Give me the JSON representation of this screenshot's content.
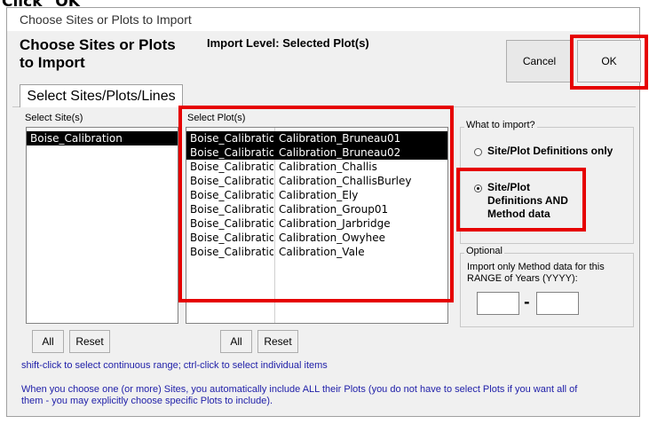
{
  "caption": "Click \"OK\"",
  "window": {
    "title": "Choose Sites or Plots to Import"
  },
  "header": {
    "heading": "Choose Sites or Plots to Import",
    "import_level": "Import Level: Selected Plot(s)"
  },
  "buttons": {
    "cancel": "Cancel",
    "ok": "OK"
  },
  "tab": {
    "label": "Select Sites/Plots/Lines"
  },
  "sites": {
    "label": "Select Site(s)",
    "items": [
      {
        "name": "Boise_Calibration",
        "selected": true
      }
    ],
    "all_label": "All",
    "reset_label": "Reset"
  },
  "plots": {
    "label": "Select Plot(s)",
    "rows": [
      {
        "site": "Boise_Calibratio",
        "plot": "Calibration_Bruneau01",
        "selected": true
      },
      {
        "site": "Boise_Calibratio",
        "plot": "Calibration_Bruneau02",
        "selected": true
      },
      {
        "site": "Boise_Calibratio",
        "plot": "Calibration_Challis",
        "selected": false
      },
      {
        "site": "Boise_Calibratio",
        "plot": "Calibration_ChallisBurley",
        "selected": false
      },
      {
        "site": "Boise_Calibratio",
        "plot": "Calibration_Ely",
        "selected": false
      },
      {
        "site": "Boise_Calibratio",
        "plot": "Calibration_Group01",
        "selected": false
      },
      {
        "site": "Boise_Calibratio",
        "plot": "Calibration_Jarbridge",
        "selected": false
      },
      {
        "site": "Boise_Calibratio",
        "plot": "Calibration_Owyhee",
        "selected": false
      },
      {
        "site": "Boise_Calibratio",
        "plot": "Calibration_Vale",
        "selected": false
      }
    ],
    "all_label": "All",
    "reset_label": "Reset"
  },
  "what_to_import": {
    "legend": "What to import?",
    "option1": "Site/Plot Definitions only",
    "option2": "Site/Plot Definitions AND Method data",
    "selected": 2
  },
  "optional": {
    "legend": "Optional",
    "description": "Import only Method data for this RANGE of Years (YYYY):",
    "year_from": "",
    "year_to": "",
    "separator": "-"
  },
  "hints": {
    "selection": "shift-click to select continuous range; ctrl-click to select individual items",
    "note": "When you choose one (or more) Sites, you automatically include ALL their Plots (you do not have to select Plots if you want all of them - you may explicitly choose specific Plots to include)."
  },
  "colors": {
    "highlight": "#e60000",
    "hint_text": "#1e1ea8",
    "selection": "#000000"
  }
}
